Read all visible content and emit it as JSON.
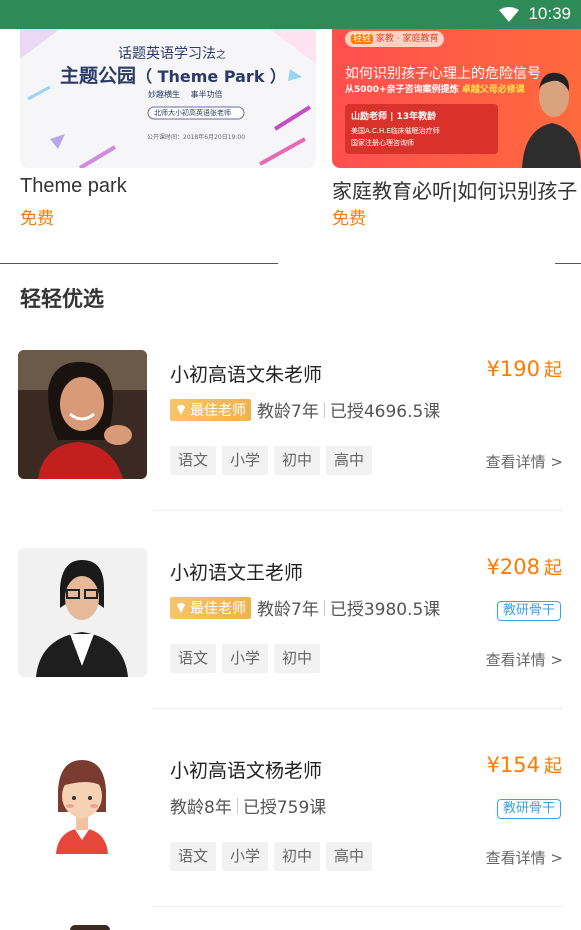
{
  "status_bar": {
    "time": "10:39"
  },
  "courses": [
    {
      "title": "Theme park",
      "price": "免费",
      "poster": {
        "small_heading": "话题英语学习法",
        "suffix": "之",
        "main_heading": "主题公园",
        "english": "（ Theme Park ）",
        "slogan_left": "妙趣横生",
        "slogan_right": "事半功倍",
        "teacher_pill": "北师大小初高英语张老师",
        "date_line": "公开课时间：2018年6月20日19:00"
      }
    },
    {
      "title": "家庭教育必听|如何识别孩子",
      "price": "免费",
      "poster": {
        "brand_logo": "轻轻",
        "brand_tag": "家教 · 家庭教育",
        "headline": "如何识别孩子心理上的危险信号",
        "subline": "从5000+亲子咨询案例提炼",
        "subline_hl": "卓越父母必修课",
        "box_title": "山励老师 | 13年教龄",
        "box_line1": "美国A.C.H.E临床催眠治疗师",
        "box_line2": "国家注册心理咨询师"
      }
    }
  ],
  "section": {
    "title": "轻轻优选"
  },
  "teachers": [
    {
      "name": "小初高语文朱老师",
      "price": "¥190",
      "price_suffix": "起",
      "best_badge": "最佳老师",
      "years": "教龄7年",
      "taught": "已授4696.5课",
      "research_badge": "",
      "subjects": [
        "语文",
        "小学",
        "初中",
        "高中"
      ],
      "detail": "查看详情 >"
    },
    {
      "name": "小初语文王老师",
      "price": "¥208",
      "price_suffix": "起",
      "best_badge": "最佳老师",
      "years": "教龄7年",
      "taught": "已授3980.5课",
      "research_badge": "教研骨干",
      "subjects": [
        "语文",
        "小学",
        "初中"
      ],
      "detail": "查看详情 >"
    },
    {
      "name": "小初高语文杨老师",
      "price": "¥154",
      "price_suffix": "起",
      "best_badge": "",
      "years": "教龄8年",
      "taught": "已授759课",
      "research_badge": "教研骨干",
      "subjects": [
        "语文",
        "小学",
        "初中",
        "高中"
      ],
      "detail": "查看详情 >"
    }
  ],
  "colors": {
    "status_bar": "#2e8b57",
    "price": "#ff7a00",
    "badge_blue": "#3ba3e8",
    "badge_gold": "#f0b24e"
  }
}
